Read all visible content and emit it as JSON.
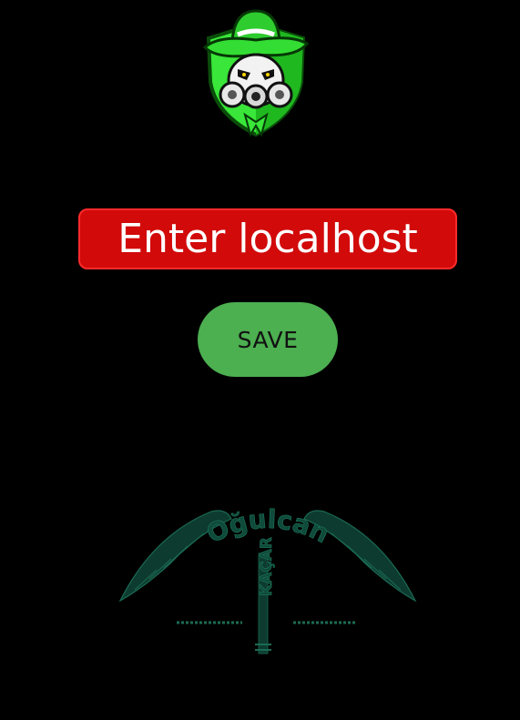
{
  "host_input": {
    "placeholder": "Enter localhost"
  },
  "save_button": {
    "label": "SAVE"
  },
  "watermark": {
    "first_name": "Oğulcan",
    "last_name": "KAÇAR"
  },
  "colors": {
    "background": "#000000",
    "input_bg": "#d20a0a",
    "button_bg": "#4caf50",
    "logo_green": "#39e639",
    "watermark": "#0f4a3a"
  },
  "icons": {
    "logo": "gasmask-cowboy-shield-icon",
    "watermark": "bow-signature-logo"
  }
}
